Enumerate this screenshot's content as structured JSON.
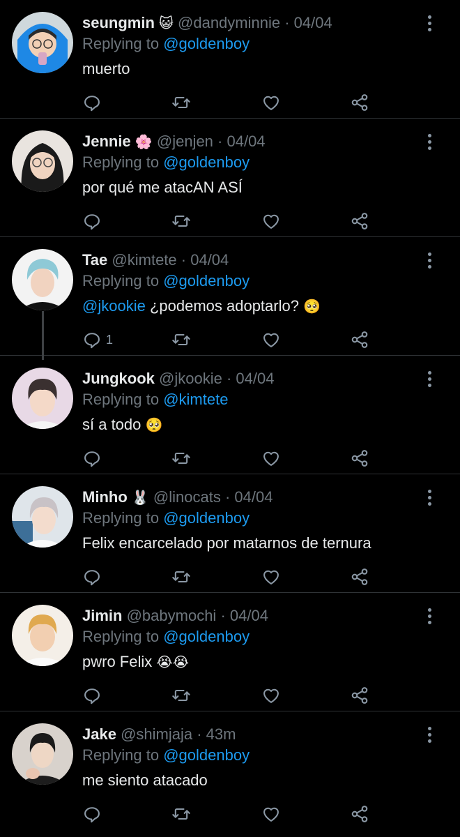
{
  "replying_label": "Replying to",
  "colors": {
    "accent": "#1d9bf0",
    "muted": "#6e767d",
    "background": "#000000"
  },
  "tweets": [
    {
      "name": "seungmin",
      "emoji": "😺",
      "handle": "@dandyminnie",
      "time": "· 04/04",
      "reply_to": "@goldenboy",
      "mention": "",
      "text": "muerto",
      "text_emoji": "",
      "reply_count": ""
    },
    {
      "name": "Jennie",
      "emoji": "🌸",
      "handle": "@jenjen",
      "time": "· 04/04",
      "reply_to": "@goldenboy",
      "mention": "",
      "text": "por qué me atacAN ASÍ",
      "text_emoji": "",
      "reply_count": ""
    },
    {
      "name": "Tae",
      "emoji": "",
      "handle": "@kimtete",
      "time": "· 04/04",
      "reply_to": "@goldenboy",
      "mention": "@jkookie",
      "text": " ¿podemos adoptarlo?",
      "text_emoji": "🥺",
      "reply_count": "1"
    },
    {
      "name": "Jungkook",
      "emoji": "",
      "handle": "@jkookie",
      "time": "· 04/04",
      "reply_to": "@kimtete",
      "mention": "",
      "text": "sí a todo",
      "text_emoji": "🥺",
      "reply_count": ""
    },
    {
      "name": "Minho",
      "emoji": "🐰",
      "handle": "@linocats",
      "time": "· 04/04",
      "reply_to": "@goldenboy",
      "mention": "",
      "text": "Felix encarcelado por matarnos de ternura",
      "text_emoji": "",
      "reply_count": ""
    },
    {
      "name": "Jimin",
      "emoji": "",
      "handle": "@babymochi",
      "time": "· 04/04",
      "reply_to": "@goldenboy",
      "mention": "",
      "text": "pwro Felix",
      "text_emoji": "😭😭",
      "reply_count": ""
    },
    {
      "name": "Jake",
      "emoji": "",
      "handle": "@shimjaja",
      "time": "· 43m",
      "reply_to": "@goldenboy",
      "mention": "",
      "text": "me siento atacado",
      "text_emoji": "",
      "reply_count": ""
    }
  ]
}
